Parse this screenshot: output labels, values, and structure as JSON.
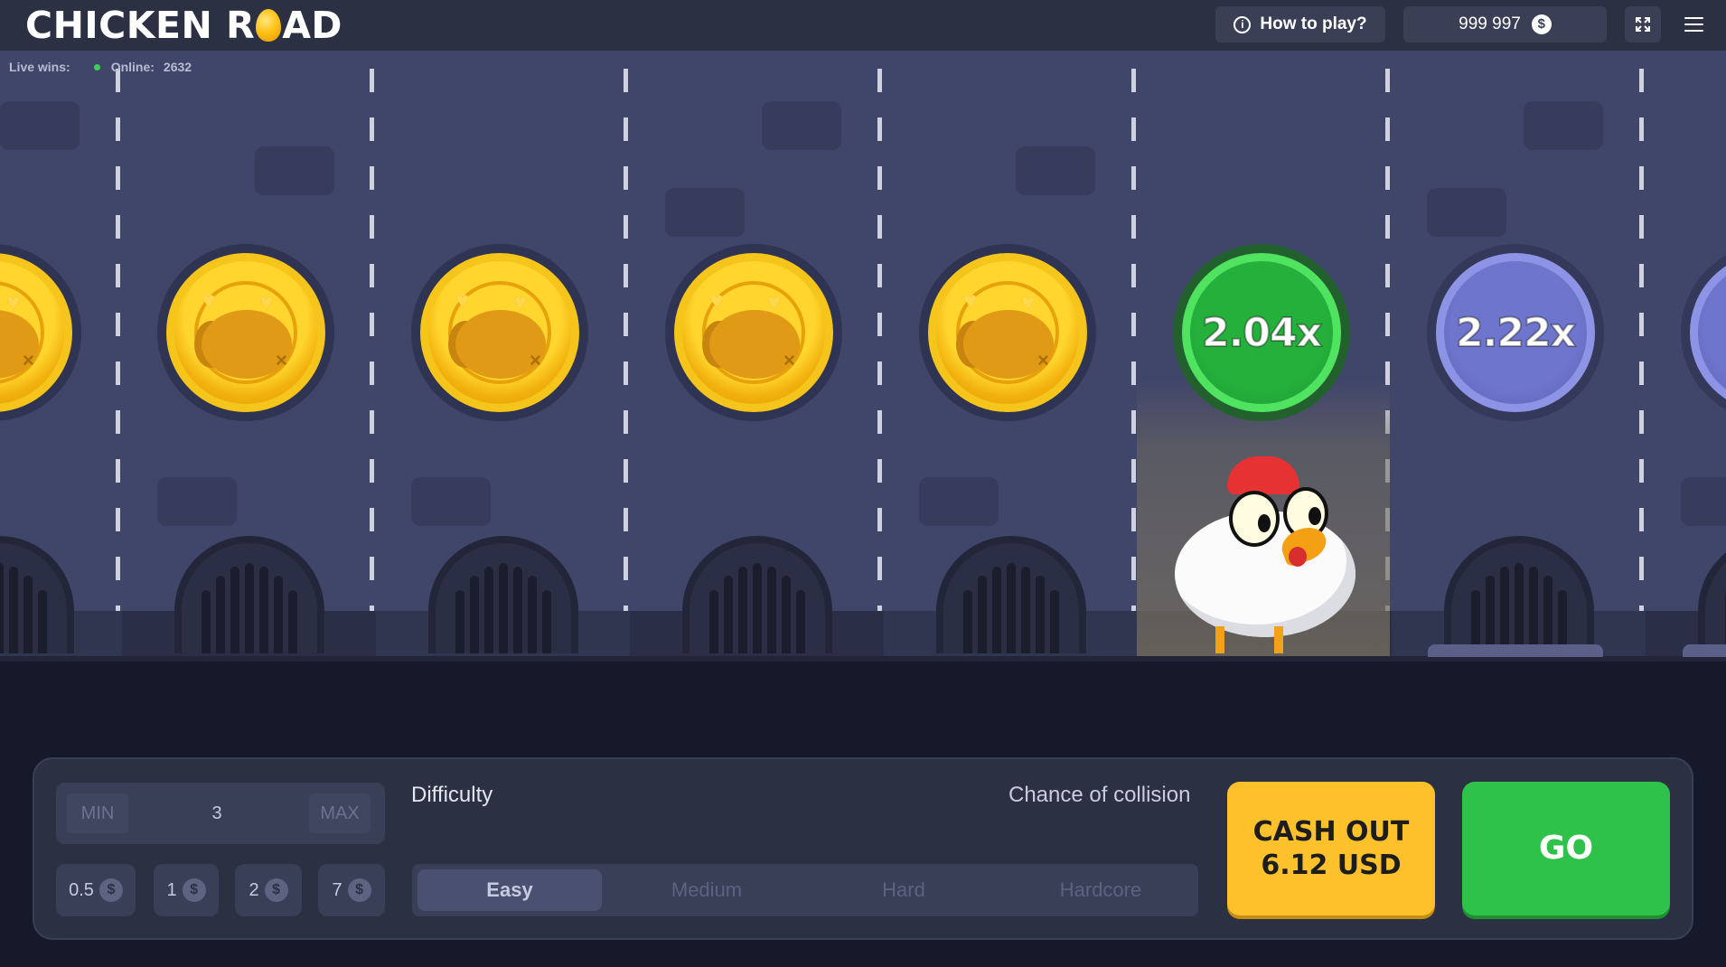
{
  "header": {
    "logo_left": "CHICKEN R",
    "logo_right": "AD",
    "how_to_play": "How to play?",
    "info_icon": "info-icon",
    "balance": "999 997",
    "currency_icon": "$",
    "fullscreen_icon": "expand-icon",
    "menu_icon": "hamburger-menu-icon"
  },
  "stats": {
    "live_wins_label": "Live wins:",
    "online_label": "Online:",
    "online_count": "2632"
  },
  "lanes": [
    {
      "state": "passed"
    },
    {
      "state": "passed"
    },
    {
      "state": "passed"
    },
    {
      "state": "passed"
    },
    {
      "state": "passed"
    },
    {
      "state": "current",
      "multiplier": "2.04x"
    },
    {
      "state": "next",
      "multiplier": "2.22x"
    }
  ],
  "controls": {
    "min_label": "MIN",
    "bet_value": "3",
    "max_label": "MAX",
    "chips": [
      "0.5",
      "1",
      "2",
      "7"
    ],
    "chip_currency": "$",
    "difficulty_label": "Difficulty",
    "collision_label": "Chance of collision",
    "difficulties": [
      "Easy",
      "Medium",
      "Hard",
      "Hardcore"
    ],
    "selected_difficulty": "Easy",
    "cashout_line1": "CASH OUT",
    "cashout_line2": "6.12 USD",
    "go_label": "GO"
  },
  "colors": {
    "accent_yellow": "#fdc12b",
    "accent_green": "#2fc24a",
    "road": "#40466a",
    "header": "#2c3043"
  }
}
